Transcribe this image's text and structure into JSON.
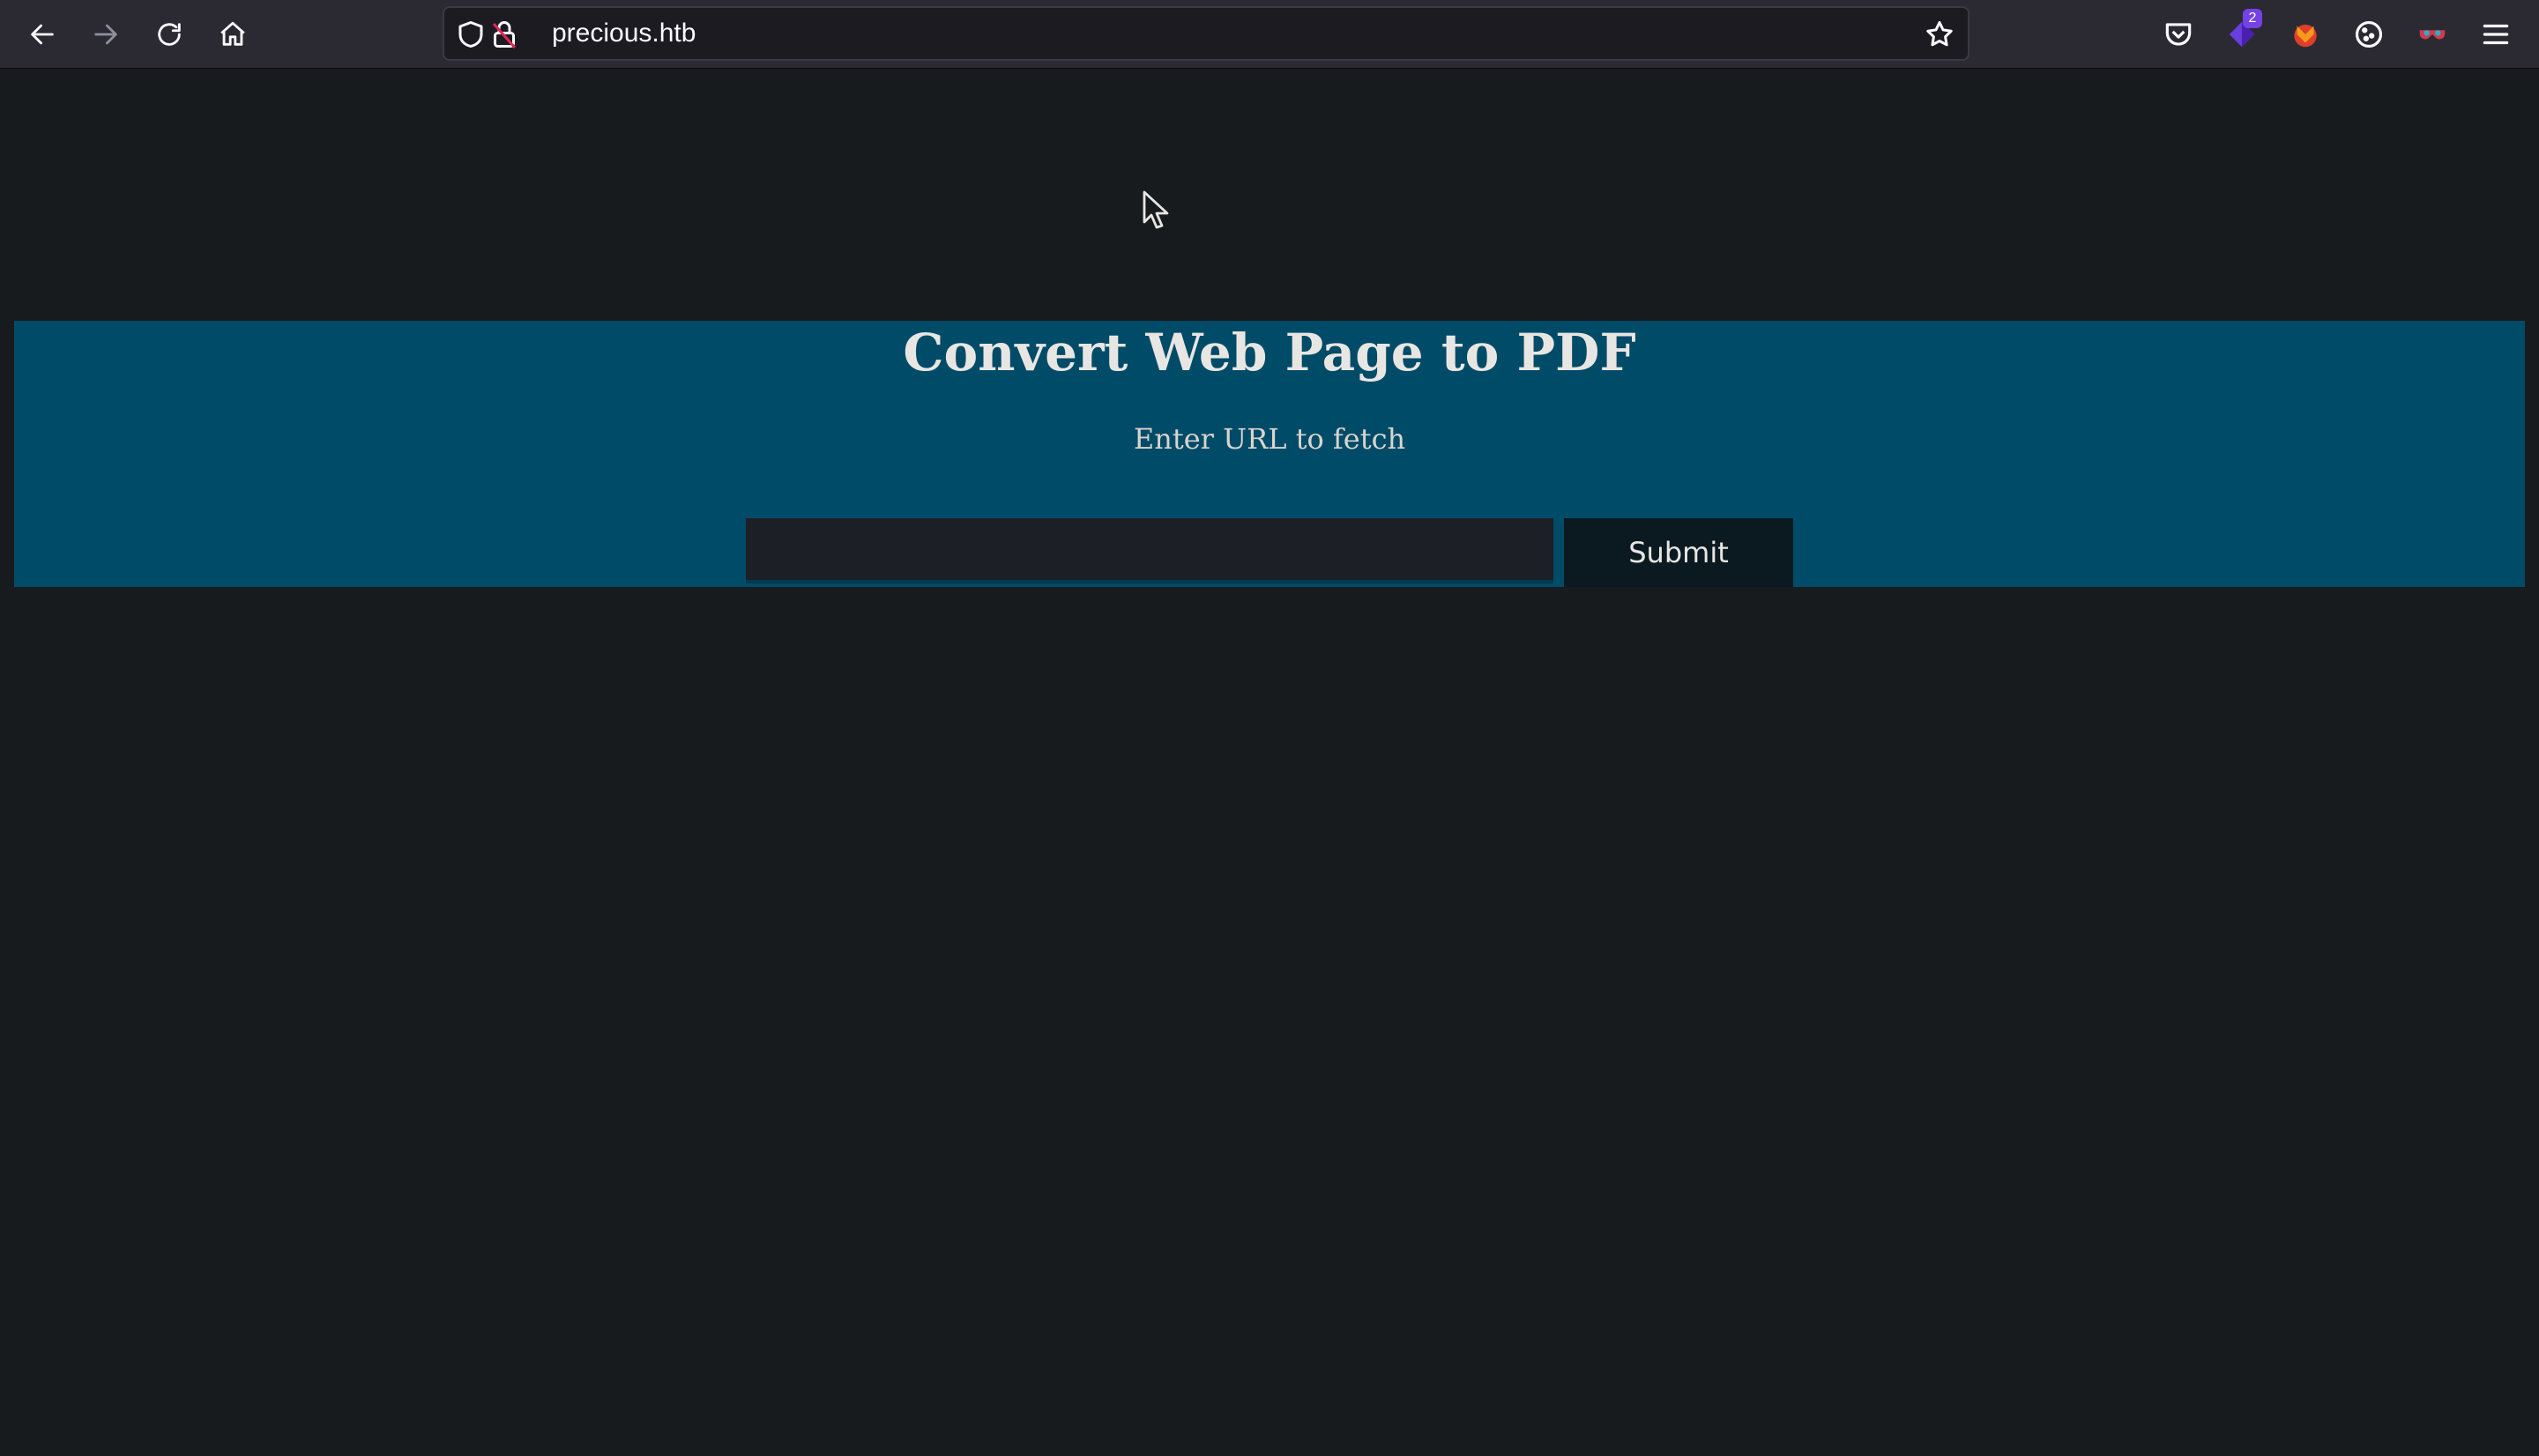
{
  "browser": {
    "url": "precious.htb",
    "extensions": [
      {
        "icon": "pocket-icon"
      },
      {
        "icon": "extension-purple-icon",
        "badge": "2"
      },
      {
        "icon": "extension-fox-icon"
      },
      {
        "icon": "cookie-icon"
      },
      {
        "icon": "extension-mask-icon"
      }
    ],
    "menu_icon": "hamburger-menu-icon"
  },
  "page": {
    "title": "Convert Web Page to PDF",
    "subtitle": "Enter URL to fetch",
    "url_input": {
      "value": "",
      "placeholder": ""
    },
    "submit_label": "Submit"
  },
  "colors": {
    "page_background": "#181b1d",
    "banner_background": "#004b67",
    "toolbar_background": "#2b2a33",
    "submit_background": "#0b1a21"
  }
}
